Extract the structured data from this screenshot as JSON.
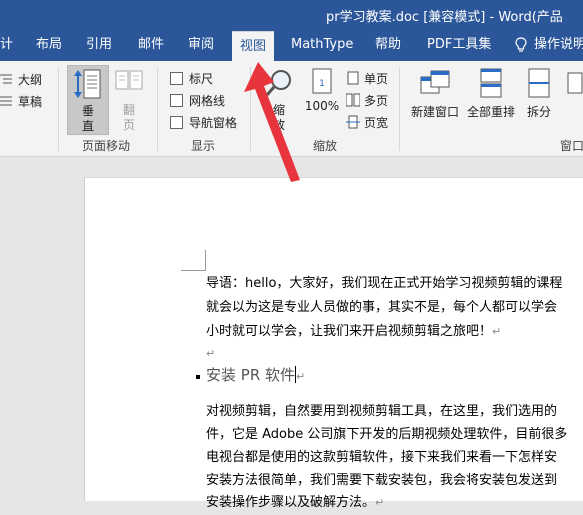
{
  "window": {
    "title": "pr学习教案.doc [兼容模式] - Word(产品"
  },
  "tabs": [
    {
      "label": "计"
    },
    {
      "label": "布局"
    },
    {
      "label": "引用"
    },
    {
      "label": "邮件"
    },
    {
      "label": "审阅"
    },
    {
      "label": "视图"
    },
    {
      "label": "MathType"
    },
    {
      "label": "帮助"
    },
    {
      "label": "PDF工具集"
    },
    {
      "label": "操作说明"
    }
  ],
  "ribbon": {
    "views": {
      "outline": "大纲",
      "draft": "草稿"
    },
    "page_movement": {
      "vertical": "垂直",
      "side_to_side": "翻页",
      "group_label": "页面移动"
    },
    "show": {
      "ruler": "标尺",
      "gridlines": "网格线",
      "nav_pane": "导航窗格",
      "group_label": "显示"
    },
    "zoom": {
      "zoom": "缩放",
      "percent": "100%",
      "one_page": "单页",
      "multiple_pages": "多页",
      "page_width": "页宽",
      "group_label": "缩放"
    },
    "window": {
      "new_window": "新建窗口",
      "arrange_all": "全部重排",
      "split": "拆分",
      "group_label": "窗口"
    }
  },
  "document": {
    "intro_lines": [
      "导语：hello，大家好，我们现在正式开始学习视频剪辑的课程",
      "就会以为这是专业人员做的事，其实不是，每个人都可以学会",
      "小时就可以学会，让我们来开启视频剪辑之旅吧！"
    ],
    "heading": "安装 PR 软件",
    "body_lines": [
      "对视频剪辑，自然要用到视频剪辑工具，在这里，我们选用的",
      "件，它是 Adobe 公司旗下开发的后期视频处理软件，目前很多",
      "电视台都是使用的这款剪辑软件，接下来我们来看一下怎样安",
      "安装方法很简单，我们需要下载安装包，我会将安装包发送到",
      "安装操作步骤以及破解方法。"
    ],
    "para_mark": "↵"
  },
  "colors": {
    "title_bar": "#2b579a",
    "ribbon": "#f3f3f3",
    "arrow": "#e8343c"
  }
}
